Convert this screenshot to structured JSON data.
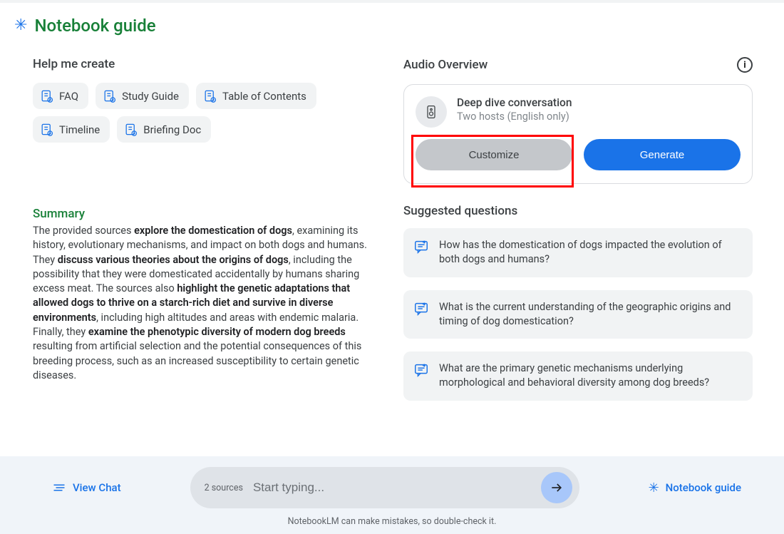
{
  "header": {
    "title": "Notebook guide"
  },
  "help": {
    "title": "Help me create",
    "chips": [
      "FAQ",
      "Study Guide",
      "Table of Contents",
      "Timeline",
      "Briefing Doc"
    ]
  },
  "summary": {
    "title": "Summary",
    "s1a": "The provided sources ",
    "s1b": "explore the domestication of dogs",
    "s1c": ", examining its history, evolutionary mechanisms, and impact on both dogs and humans. They ",
    "s1d": "discuss various theories about the origins of dogs",
    "s1e": ", including the possibility that they were domesticated accidentally by humans sharing excess meat. The sources also ",
    "s1f": "highlight the genetic adaptations that allowed dogs to thrive on a starch-rich diet and survive in diverse environments",
    "s1g": ", including high altitudes and areas with endemic malaria. Finally, they ",
    "s1h": "examine the phenotypic diversity of modern dog breeds",
    "s1i": " resulting from artificial selection and the potential consequences of this breeding process, such as an increased susceptibility to certain genetic diseases."
  },
  "audio": {
    "title": "Audio Overview",
    "deep_title": "Deep dive conversation",
    "deep_sub": "Two hosts (English only)",
    "customize": "Customize",
    "generate": "Generate"
  },
  "suggested": {
    "title": "Suggested questions",
    "q1": "How has the domestication of dogs impacted the evolution of both dogs and humans?",
    "q2": "What is the current understanding of the geographic origins and timing of dog domestication?",
    "q3": "What are the primary genetic mechanisms underlying morphological and behavioral diversity among dog breeds?"
  },
  "footer": {
    "view_chat": "View Chat",
    "sources": "2 sources",
    "placeholder": "Start typing...",
    "guide": "Notebook guide",
    "disclaimer": "NotebookLM can make mistakes, so double-check it."
  }
}
